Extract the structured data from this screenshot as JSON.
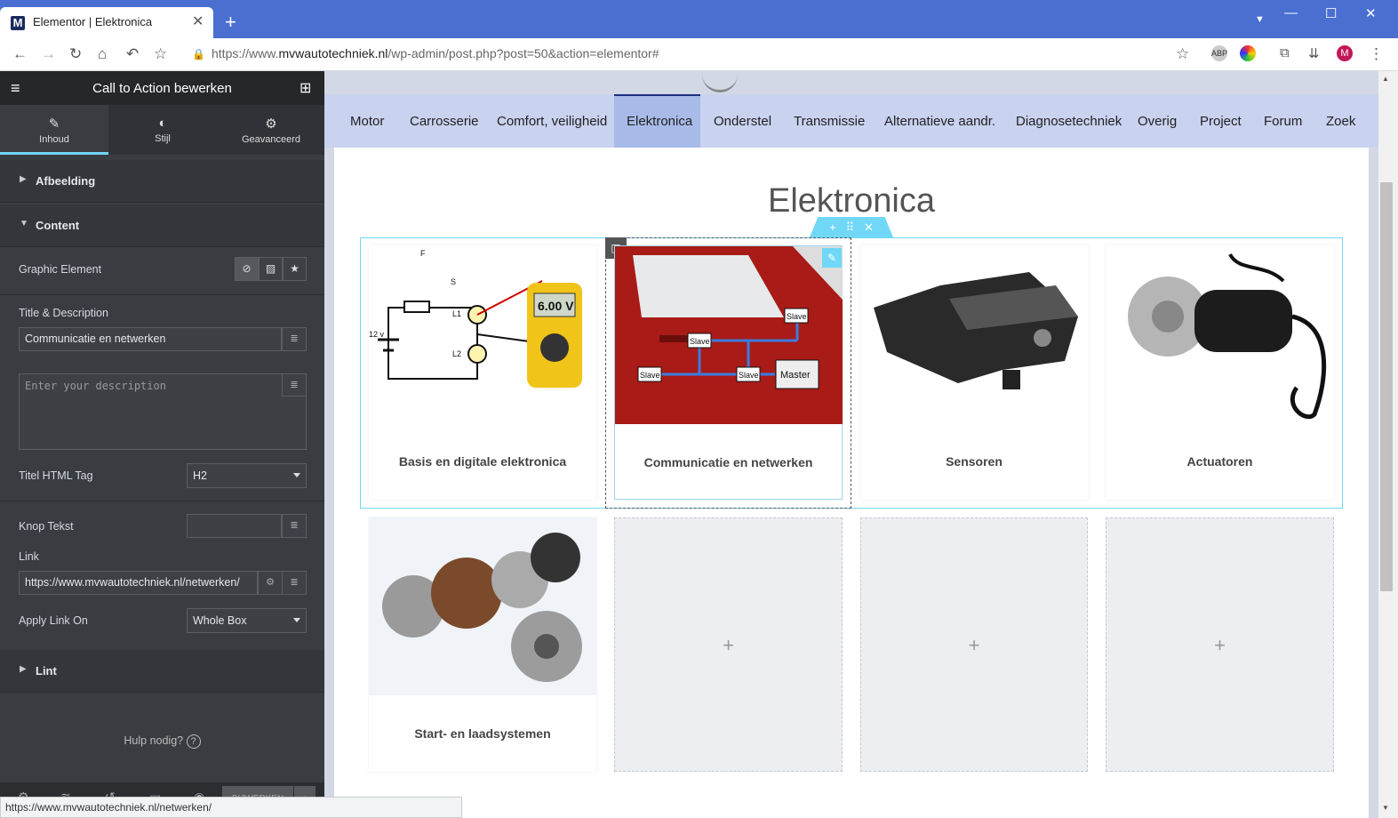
{
  "browser": {
    "tab_title": "Elementor | Elektronica",
    "favicon_letter": "M",
    "url_prefix": "https://www.",
    "url_domain": "mvwautotechniek.nl",
    "url_path": "/wp-admin/post.php?post=50&action=elementor#",
    "profile_initial": "M",
    "ext_abp": "ABP"
  },
  "panel": {
    "title": "Call to Action bewerken",
    "tabs": [
      {
        "label": "Inhoud"
      },
      {
        "label": "Stijl"
      },
      {
        "label": "Geavanceerd"
      }
    ],
    "sections": {
      "afbeelding": "Afbeelding",
      "content": "Content",
      "lint": "Lint"
    },
    "graphic_element_label": "Graphic Element",
    "title_desc_label": "Title & Description",
    "title_value": "Communicatie en netwerken",
    "description_placeholder": "Enter your description",
    "html_tag_label": "Titel HTML Tag",
    "html_tag_value": "H2",
    "button_text_label": "Knop Tekst",
    "button_text_value": "",
    "link_label": "Link",
    "link_value": "https://www.mvwautotechniek.nl/netwerken/",
    "apply_link_label": "Apply Link On",
    "apply_link_value": "Whole Box",
    "help_text": "Hulp nodig?",
    "update_button": "BIJWERKEN"
  },
  "site": {
    "menu": [
      "Motor",
      "Carrosserie",
      "Comfort, veiligheid",
      "Elektronica",
      "Onderstel",
      "Transmissie",
      "Alternatieve aandr.",
      "Diagnosetechniek",
      "Overig",
      "Project",
      "Forum",
      "Zoek"
    ],
    "page_title": "Elektronica",
    "cards": [
      {
        "caption": "Basis en digitale elektronica",
        "img_labels": {
          "meter": "6.00 V",
          "battery": "12 v",
          "f": "F",
          "s": "S",
          "l1": "L1",
          "l2": "L2"
        }
      },
      {
        "caption": "Communicatie en netwerken",
        "img_labels": {
          "slave": "Slave",
          "master": "Master"
        }
      },
      {
        "caption": "Sensoren"
      },
      {
        "caption": "Actuatoren"
      },
      {
        "caption": "Start- en laadsystemen"
      }
    ],
    "empty_placeholder": "+"
  },
  "status_url": "https://www.mvwautotechniek.nl/netwerken/"
}
